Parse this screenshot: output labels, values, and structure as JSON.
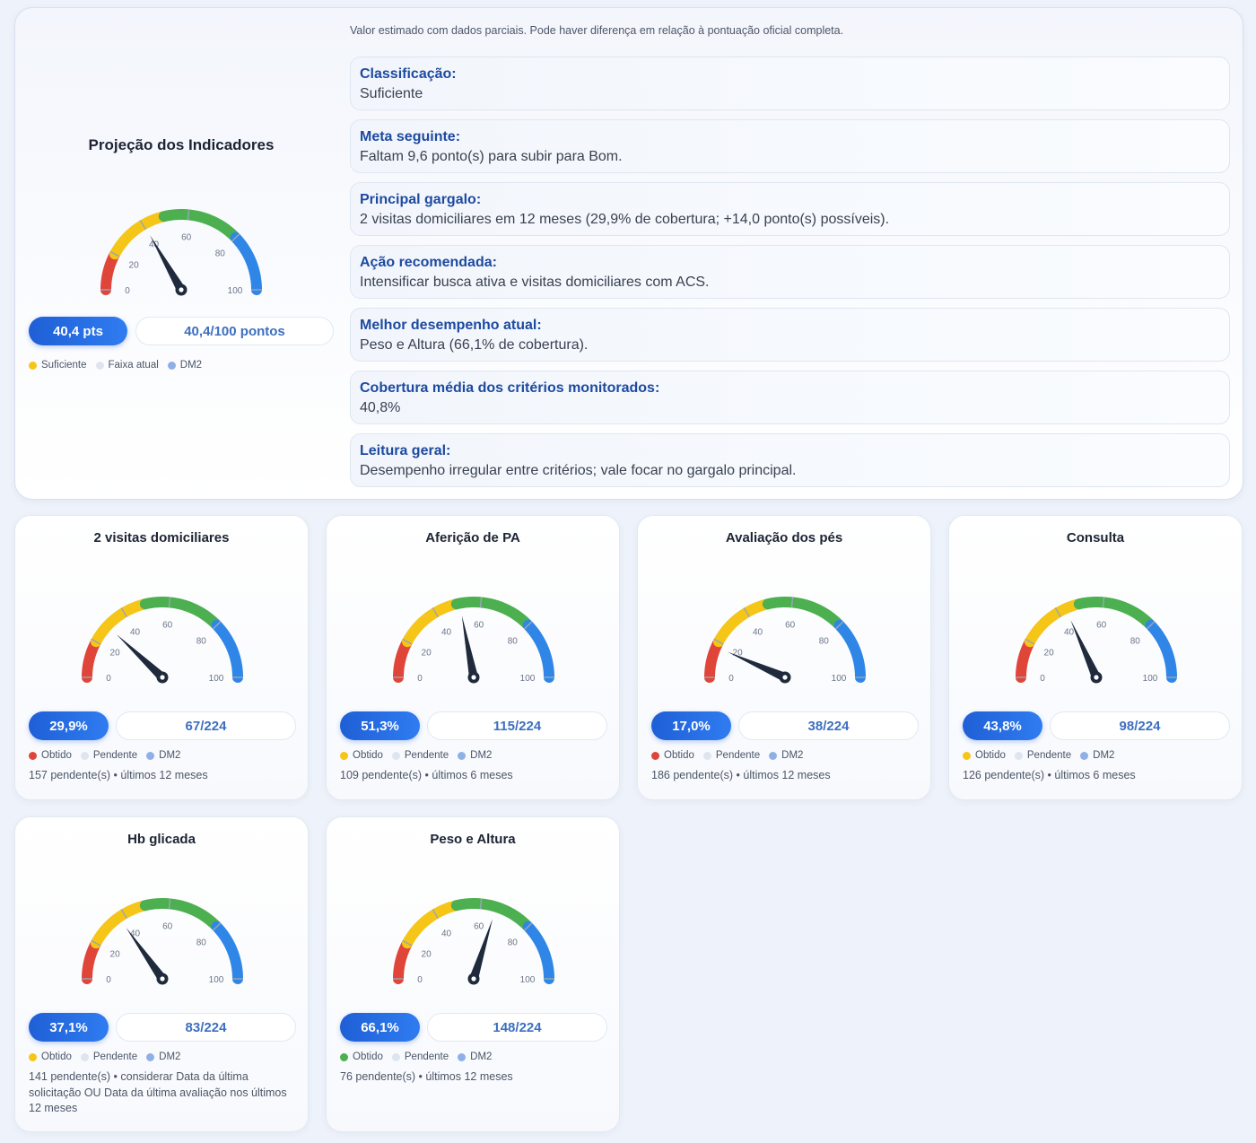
{
  "summary": {
    "title": "Projeção dos Indicadores",
    "note": "Valor estimado com dados parciais. Pode haver diferença em relação à pontuação oficial completa.",
    "score_pill": "40,4 pts",
    "points_pill": "40,4/100 pontos",
    "gauge_value": 40.4,
    "legend": [
      {
        "label": "Suficiente",
        "color": "#f5c518"
      },
      {
        "label": "Faixa atual",
        "color": "#dfe5ef"
      },
      {
        "label": "DM2",
        "color": "#8fb0e6"
      }
    ],
    "info": [
      {
        "label": "Classificação:",
        "value": "Suficiente"
      },
      {
        "label": "Meta seguinte:",
        "value": "Faltam 9,6 ponto(s) para subir para Bom."
      },
      {
        "label": "Principal gargalo:",
        "value": "2 visitas domiciliares em 12 meses (29,9% de cobertura; +14,0 ponto(s) possíveis)."
      },
      {
        "label": "Ação recomendada:",
        "value": "Intensificar busca ativa e visitas domiciliares com ACS."
      },
      {
        "label": "Melhor desempenho atual:",
        "value": "Peso e Altura (66,1% de cobertura)."
      },
      {
        "label": "Cobertura média dos critérios monitorados:",
        "value": "40,8%"
      },
      {
        "label": "Leitura geral:",
        "value": "Desempenho irregular entre critérios; vale focar no gargalo principal."
      }
    ]
  },
  "gauge_ticks": [
    "0",
    "20",
    "40",
    "60",
    "80",
    "100"
  ],
  "colors": {
    "red": "#e0453a",
    "yellow": "#f5c518",
    "green": "#4caf50",
    "blue": "#2f86e6",
    "accent": "#2f6fe0",
    "needle": "#1f2a3c"
  },
  "indicators": [
    {
      "title": "2 visitas domiciliares",
      "percent": 29.9,
      "percent_label": "29,9%",
      "count": "67/224",
      "legend": [
        {
          "label": "Obtido",
          "color": "#e0453a"
        },
        {
          "label": "Pendente",
          "color": "#dfe5ef"
        },
        {
          "label": "DM2",
          "color": "#8fb0e6"
        }
      ],
      "footer": "157 pendente(s) • últimos 12 meses"
    },
    {
      "title": "Aferição de PA",
      "percent": 51.3,
      "percent_label": "51,3%",
      "count": "115/224",
      "legend": [
        {
          "label": "Obtido",
          "color": "#f5c518"
        },
        {
          "label": "Pendente",
          "color": "#dfe5ef"
        },
        {
          "label": "DM2",
          "color": "#8fb0e6"
        }
      ],
      "footer": "109 pendente(s) • últimos 6 meses"
    },
    {
      "title": "Avaliação dos pés",
      "percent": 17.0,
      "percent_label": "17,0%",
      "count": "38/224",
      "legend": [
        {
          "label": "Obtido",
          "color": "#e0453a"
        },
        {
          "label": "Pendente",
          "color": "#dfe5ef"
        },
        {
          "label": "DM2",
          "color": "#8fb0e6"
        }
      ],
      "footer": "186 pendente(s) • últimos 12 meses"
    },
    {
      "title": "Consulta",
      "percent": 43.8,
      "percent_label": "43,8%",
      "count": "98/224",
      "legend": [
        {
          "label": "Obtido",
          "color": "#f5c518"
        },
        {
          "label": "Pendente",
          "color": "#dfe5ef"
        },
        {
          "label": "DM2",
          "color": "#8fb0e6"
        }
      ],
      "footer": "126 pendente(s) • últimos 6 meses"
    },
    {
      "title": "Hb glicada",
      "percent": 37.1,
      "percent_label": "37,1%",
      "count": "83/224",
      "legend": [
        {
          "label": "Obtido",
          "color": "#f5c518"
        },
        {
          "label": "Pendente",
          "color": "#dfe5ef"
        },
        {
          "label": "DM2",
          "color": "#8fb0e6"
        }
      ],
      "footer": "141 pendente(s) • considerar Data da última solicitação OU Data da última avaliação nos últimos 12 meses"
    },
    {
      "title": "Peso e Altura",
      "percent": 66.1,
      "percent_label": "66,1%",
      "count": "148/224",
      "legend": [
        {
          "label": "Obtido",
          "color": "#4caf50"
        },
        {
          "label": "Pendente",
          "color": "#dfe5ef"
        },
        {
          "label": "DM2",
          "color": "#8fb0e6"
        }
      ],
      "footer": "76 pendente(s) • últimos 12 meses"
    }
  ]
}
